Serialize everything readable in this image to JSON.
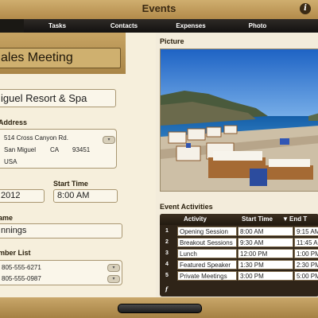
{
  "app": {
    "title": "Events"
  },
  "tabs": [
    {
      "label": ""
    },
    {
      "label": "Tasks"
    },
    {
      "label": "Contacts"
    },
    {
      "label": "Expenses"
    },
    {
      "label": "Photo"
    }
  ],
  "event": {
    "name": "ales Meeting",
    "location": "iguel Resort & Spa",
    "address_label": "Address",
    "address": {
      "line1": "514 Cross Canyon Rd.",
      "city": "San Miguel",
      "state": "CA",
      "zip": "93451",
      "country": "USA"
    },
    "date": "2012",
    "start_time_label": "Start Time",
    "start_time": "8:00 AM",
    "name_label": "ame",
    "contact_name": "nnings",
    "phone_label": "mber List",
    "phones": [
      "805-555-6271",
      "805-555-0987"
    ]
  },
  "picture": {
    "label": "Picture"
  },
  "activities": {
    "label": "Event Activities",
    "columns": [
      "Activity",
      "Start Time",
      "End T"
    ],
    "rows": [
      {
        "num": "1",
        "activity": "Opening Session",
        "start": "8:00 AM",
        "end": "9:15 AM"
      },
      {
        "num": "2",
        "activity": "Breakout Sessions",
        "start": "9:30 AM",
        "end": "11:45 A"
      },
      {
        "num": "3",
        "activity": "Lunch",
        "start": "12:00 PM",
        "end": "1:00 PM"
      },
      {
        "num": "4",
        "activity": "Featured Speaker",
        "start": "1:30 PM",
        "end": "2:30 PM"
      },
      {
        "num": "5",
        "activity": "Private Meetings",
        "start": "3:00 PM",
        "end": "5:00 PM"
      }
    ],
    "footer_glyph": "f"
  },
  "colors": {
    "accent": "#b8924f",
    "dark": "#2f2418"
  }
}
